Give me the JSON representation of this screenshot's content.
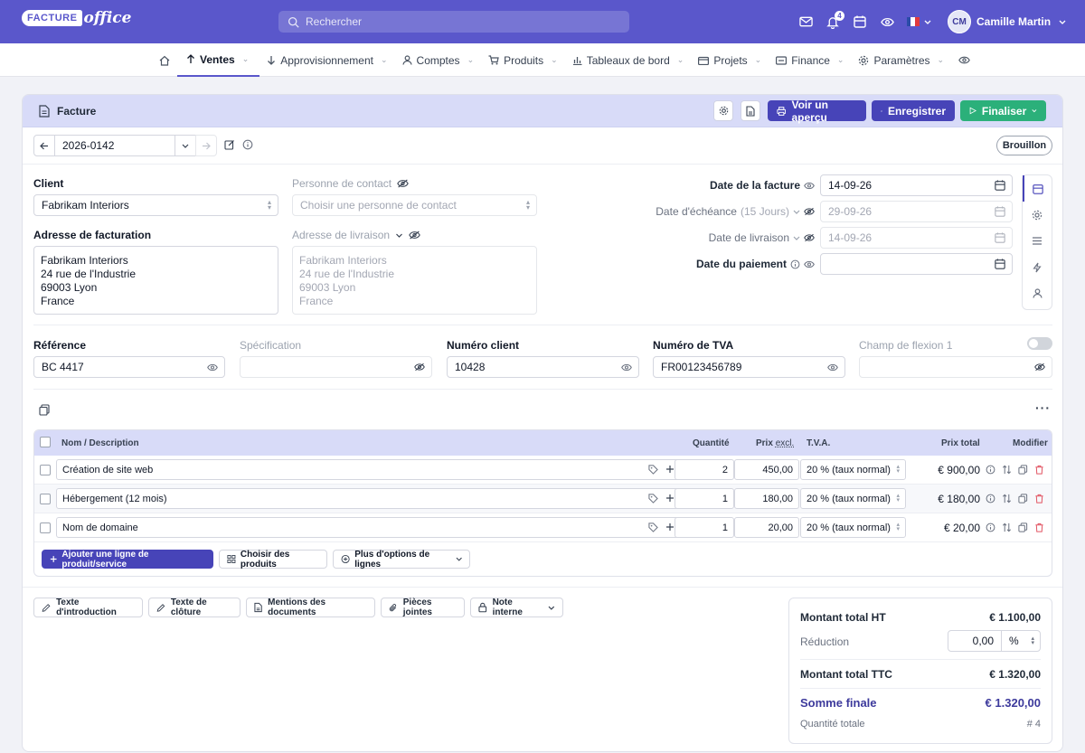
{
  "brand": {
    "part1": "FACTURE",
    "part2": "office"
  },
  "search": {
    "placeholder": "Rechercher"
  },
  "notifications": {
    "count": "4"
  },
  "user": {
    "initials": "CM",
    "name": "Camille Martin"
  },
  "nav": {
    "items": [
      "Ventes",
      "Approvisionnement",
      "Comptes",
      "Produits",
      "Tableaux de bord",
      "Projets",
      "Finance",
      "Paramètres"
    ]
  },
  "header": {
    "title": "Facture",
    "preview": "Voir un aperçu",
    "save": "Enregistrer",
    "finalize": "Finaliser"
  },
  "invoice": {
    "number": "2026-0142",
    "status": "Brouillon"
  },
  "client": {
    "label": "Client",
    "value": "Fabrikam Interiors",
    "contact_label": "Personne de contact",
    "contact_placeholder": "Choisir une personne de contact",
    "billing_label": "Adresse de facturation",
    "billing_lines": [
      "Fabrikam Interiors",
      "24 rue de l'Industrie",
      "69003 Lyon",
      "France"
    ],
    "shipping_label": "Adresse de livraison",
    "shipping_lines": [
      "Fabrikam Interiors",
      "24 rue de l'Industrie",
      "69003 Lyon",
      "France"
    ]
  },
  "dates": {
    "invoice_label": "Date de la facture",
    "invoice_value": "14-09-26",
    "due_label": "Date d'échéance",
    "due_hint": "(15 Jours)",
    "due_value": "29-09-26",
    "delivery_label": "Date de livraison",
    "delivery_value": "14-09-26",
    "payment_label": "Date du paiement",
    "payment_value": ""
  },
  "fields": {
    "reference_label": "Référence",
    "reference_value": "BC 4417",
    "spec_label": "Spécification",
    "spec_value": "",
    "client_no_label": "Numéro client",
    "client_no_value": "10428",
    "vat_label": "Numéro de TVA",
    "vat_value": "FR00123456789",
    "flex_label": "Champ de flexion 1",
    "flex_value": ""
  },
  "table": {
    "headers": {
      "name": "Nom / Description",
      "qty": "Quantité",
      "price": "Prix",
      "price_suffix": "excl.",
      "vat": "T.V.A.",
      "total": "Prix total",
      "edit": "Modifier"
    },
    "rows": [
      {
        "name": "Création de site web",
        "qty": "2",
        "price": "450,00",
        "vat": "20 % (taux normal)",
        "total": "€ 900,00"
      },
      {
        "name": "Hébergement (12 mois)",
        "qty": "1",
        "price": "180,00",
        "vat": "20 % (taux normal)",
        "total": "€ 180,00"
      },
      {
        "name": "Nom de domaine",
        "qty": "1",
        "price": "20,00",
        "vat": "20 % (taux normal)",
        "total": "€ 20,00"
      }
    ]
  },
  "actions": {
    "add_line": "Ajouter une ligne de produit/service",
    "choose_products": "Choisir des produits",
    "more_options": "Plus d'options de lignes"
  },
  "footer": {
    "intro": "Texte d'introduction",
    "closing": "Texte de clôture",
    "mentions": "Mentions des documents",
    "attachments": "Pièces jointes",
    "note": "Note interne"
  },
  "totals": {
    "ht_label": "Montant total HT",
    "ht_value": "€ 1.100,00",
    "discount_label": "Réduction",
    "discount_value": "0,00",
    "discount_unit": "%",
    "ttc_label": "Montant total TTC",
    "ttc_value": "€ 1.320,00",
    "final_label": "Somme finale",
    "final_value": "€ 1.320,00",
    "qty_label": "Quantité totale",
    "qty_value": "# 4"
  },
  "colors": {
    "primary": "#5a57cb",
    "button": "#4744b8",
    "success": "#2bb07a",
    "header_bg": "#d8dbf8"
  }
}
